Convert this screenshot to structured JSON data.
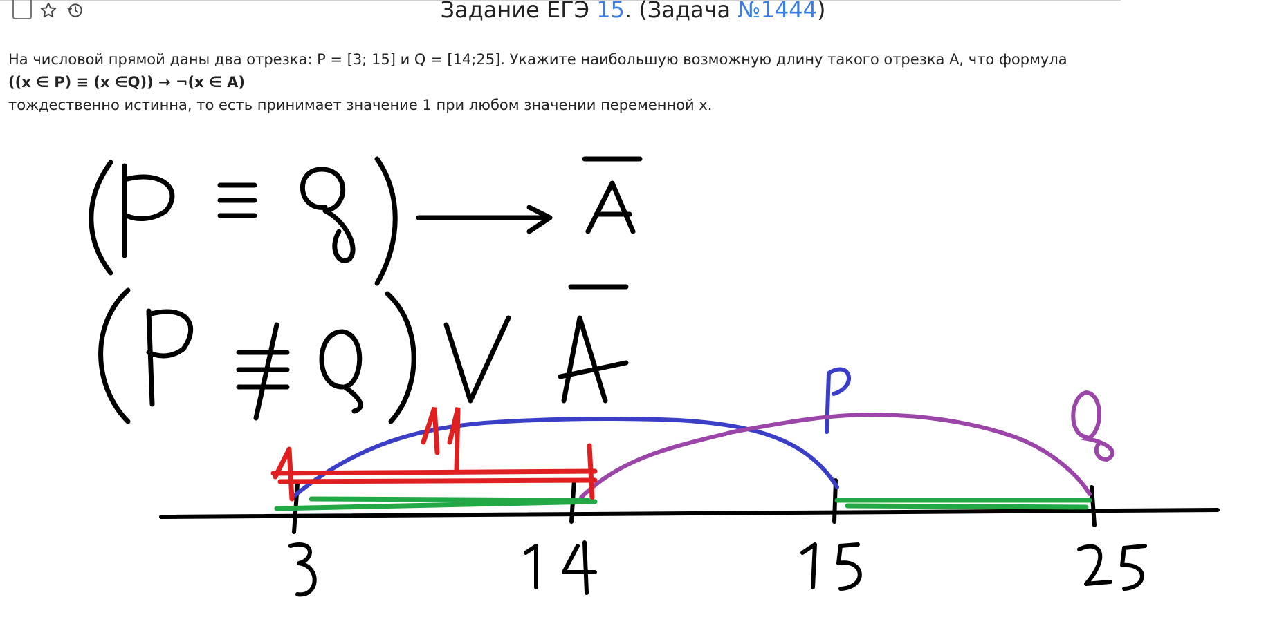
{
  "toolbar": {
    "icons": [
      "checkbox-icon",
      "star-icon",
      "history-icon"
    ]
  },
  "header": {
    "title_prefix": "Задание ЕГЭ ",
    "task_number": "15",
    "title_middle": ". (Задача ",
    "problem_id": "№1444",
    "title_suffix": ")"
  },
  "problem": {
    "line1": "На числовой прямой даны два отрезка: P = [3; 15] и Q = [14;25]. Укажите наибольшую возможную длину такого отрезка A, что формула",
    "formula": "((x ∈ P) ≡ (x ∈Q)) → ¬(x ∈ A)",
    "line3": "тождественно истинна, то есть принимает значение 1 при любом значении переменной x."
  },
  "sketch": {
    "colors": {
      "ink": "#000000",
      "segment_p": "#3b3fc8",
      "segment_q": "#9b45a8",
      "answer": "#e02020",
      "truth_region": "#22a845"
    },
    "label_p": "P",
    "label_q": "Q",
    "label_length": "11",
    "ticks": [
      "3",
      "14",
      "15",
      "25"
    ],
    "formula_line1": "(P ≡ Q) → Ā",
    "formula_line2": "(P ≢ Q) ∨ Ā"
  }
}
